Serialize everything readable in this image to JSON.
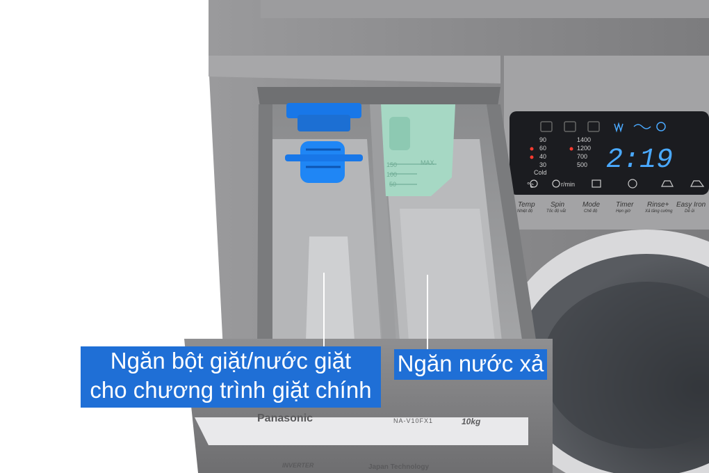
{
  "labels": {
    "main_line1": "Ngăn bột giặt/nước giặt",
    "main_line2": "cho chương trình giặt chính",
    "rinse": "Ngăn nước xả"
  },
  "machine": {
    "brand": "Panasonic",
    "model": "NA-V10FX1",
    "capacity": "10kg",
    "inverter": "INVERTER",
    "tagline": "Japan Technology"
  },
  "display": {
    "time": "2:19",
    "temp_options": [
      "90",
      "60",
      "40",
      "30",
      "Cold"
    ],
    "spin_options": [
      "1400",
      "1200",
      "700",
      "500"
    ],
    "temp_unit": "°c",
    "spin_unit": "r/min",
    "buttons": [
      {
        "label": "Temp",
        "sub": "Nhiệt độ"
      },
      {
        "label": "Spin",
        "sub": "Tốc độ vắt"
      },
      {
        "label": "Mode",
        "sub": "Chế độ"
      },
      {
        "label": "Timer",
        "sub": "Hẹn giờ"
      },
      {
        "label": "Rinse+",
        "sub": "Xả tăng cường"
      },
      {
        "label": "Easy Iron",
        "sub": "Dễ ủi"
      }
    ]
  },
  "softener_scale": {
    "max": "MAX",
    "marks": [
      "150",
      "100",
      "50"
    ]
  },
  "colors": {
    "label_bg": "#1f6fd6",
    "body": "#8d8d8f",
    "display_bg": "#1b1c20",
    "digit": "#4aa9ff",
    "blue_part": "#1877e8",
    "green_part": "#a6d8c4"
  }
}
